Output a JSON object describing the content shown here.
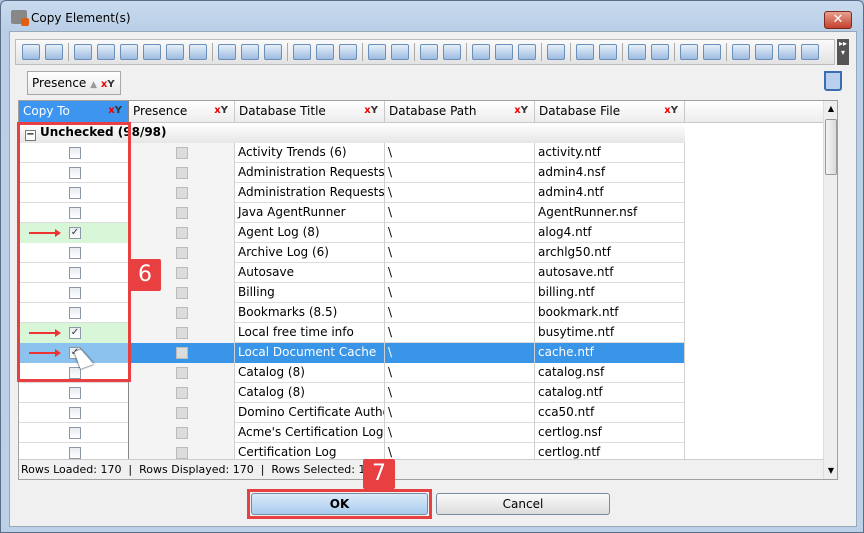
{
  "window": {
    "title": "Copy Element(s)",
    "close_icon": "close-icon"
  },
  "groupby": {
    "label": "Presence",
    "sort": "▲"
  },
  "columns": [
    "Copy To",
    "Presence",
    "Database Title",
    "Database Path",
    "Database File"
  ],
  "group": {
    "label": "Unchecked (98/98)",
    "expander": "−"
  },
  "rows": [
    {
      "copy": false,
      "title": "Activity Trends (6)",
      "path": "\\",
      "file": "activity.ntf"
    },
    {
      "copy": false,
      "title": "Administration Requests",
      "path": "\\",
      "file": "admin4.nsf"
    },
    {
      "copy": false,
      "title": "Administration Requests",
      "path": "\\",
      "file": "admin4.ntf"
    },
    {
      "copy": false,
      "title": "Java AgentRunner",
      "path": "\\",
      "file": "AgentRunner.nsf"
    },
    {
      "copy": true,
      "title": "Agent Log (8)",
      "path": "\\",
      "file": "alog4.ntf"
    },
    {
      "copy": false,
      "title": "Archive Log (6)",
      "path": "\\",
      "file": "archlg50.ntf"
    },
    {
      "copy": false,
      "title": "Autosave",
      "path": "\\",
      "file": "autosave.ntf"
    },
    {
      "copy": false,
      "title": "Billing",
      "path": "\\",
      "file": "billing.ntf"
    },
    {
      "copy": false,
      "title": "Bookmarks (8.5)",
      "path": "\\",
      "file": "bookmark.ntf"
    },
    {
      "copy": true,
      "title": "Local free time info",
      "path": "\\",
      "file": "busytime.ntf"
    },
    {
      "copy": true,
      "selected": true,
      "title": "Local Document Cache",
      "path": "\\",
      "file": "cache.ntf"
    },
    {
      "copy": false,
      "title": "Catalog (8)",
      "path": "\\",
      "file": "catalog.nsf"
    },
    {
      "copy": false,
      "title": "Catalog (8)",
      "path": "\\",
      "file": "catalog.ntf"
    },
    {
      "copy": false,
      "title": "Domino Certificate Authority",
      "path": "\\",
      "file": "cca50.ntf"
    },
    {
      "copy": false,
      "title": "Acme's Certification Log",
      "path": "\\",
      "file": "certlog.nsf"
    },
    {
      "copy": false,
      "title": "Certification Log",
      "path": "\\",
      "file": "certlog.ntf"
    }
  ],
  "status": "Rows Loaded: 170  |  Rows Displayed: 170  |  Rows Selected: 1",
  "annotations": {
    "step6": "6",
    "step7": "7"
  },
  "buttons": {
    "ok": "OK",
    "cancel": "Cancel"
  },
  "colors": {
    "accent": "#3895e8",
    "annotation": "#e84040",
    "checked_row": "#d8f7d8"
  }
}
